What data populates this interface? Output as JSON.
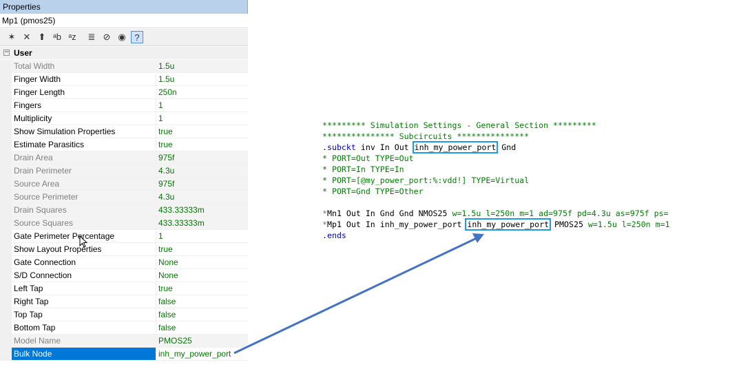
{
  "panel": {
    "title": "Properties",
    "object_name": "Mp1 (pmos25)",
    "toolbar": [
      {
        "name": "new-property-icon",
        "glyph": "✶"
      },
      {
        "name": "delete-icon",
        "glyph": "✕"
      },
      {
        "name": "move-up-icon",
        "glyph": "⬆"
      },
      {
        "name": "sort-ab-icon",
        "glyph": "ᵃb"
      },
      {
        "name": "sort-az-icon",
        "glyph": "ᵃz"
      },
      {
        "name": "stairs-icon",
        "glyph": "≣"
      },
      {
        "name": "no-entry-icon",
        "glyph": "⊘"
      },
      {
        "name": "eye-icon",
        "glyph": "◉"
      },
      {
        "name": "help-icon",
        "glyph": "?"
      }
    ],
    "category": {
      "expander": "−",
      "label": "User"
    },
    "rows": [
      {
        "name": "Total Width",
        "value": "1.5u",
        "readonly": true
      },
      {
        "name": "Finger Width",
        "value": "1.5u",
        "readonly": false
      },
      {
        "name": "Finger Length",
        "value": "250n",
        "readonly": false
      },
      {
        "name": "Fingers",
        "value": "1",
        "readonly": false
      },
      {
        "name": "Multiplicity",
        "value": "1",
        "readonly": false
      },
      {
        "name": "Show Simulation Properties",
        "value": "true",
        "readonly": false
      },
      {
        "name": "Estimate Parasitics",
        "value": "true",
        "readonly": false
      },
      {
        "name": "Drain Area",
        "value": "975f",
        "readonly": true
      },
      {
        "name": "Drain Perimeter",
        "value": "4.3u",
        "readonly": true
      },
      {
        "name": "Source Area",
        "value": "975f",
        "readonly": true
      },
      {
        "name": "Source Perimeter",
        "value": "4.3u",
        "readonly": true
      },
      {
        "name": "Drain Squares",
        "value": "433.33333m",
        "readonly": true
      },
      {
        "name": "Source Squares",
        "value": "433.33333m",
        "readonly": true
      },
      {
        "name": "Gate Perimeter Percentage",
        "value": "1",
        "readonly": false
      },
      {
        "name": "Show Layout Properties",
        "value": "true",
        "readonly": false
      },
      {
        "name": "Gate Connection",
        "value": "None",
        "readonly": false
      },
      {
        "name": "S/D Connection",
        "value": "None",
        "readonly": false
      },
      {
        "name": "Left Tap",
        "value": "true",
        "readonly": false
      },
      {
        "name": "Right Tap",
        "value": "false",
        "readonly": false
      },
      {
        "name": "Top Tap",
        "value": "false",
        "readonly": false
      },
      {
        "name": "Bottom Tap",
        "value": "false",
        "readonly": false
      },
      {
        "name": "Model Name",
        "value": "PMOS25",
        "readonly": true
      },
      {
        "name": "Bulk Node",
        "value": "inh_my_power_port",
        "readonly": false,
        "selected": true
      }
    ]
  },
  "netlist": {
    "lines": [
      {
        "cls": "c-comment",
        "text": "********* Simulation Settings - General Section *********"
      },
      {
        "cls": "c-comment",
        "text": "*************** Subcircuits ***************"
      },
      {
        "cls": "subckt"
      },
      {
        "cls": "c-comment",
        "text": "* PORT=Out TYPE=Out"
      },
      {
        "cls": "c-comment",
        "text": "* PORT=In TYPE=In"
      },
      {
        "cls": "c-comment",
        "text": "* PORT=[@my_power_port:%:vdd!] TYPE=Virtual"
      },
      {
        "cls": "c-comment",
        "text": "* PORT=Gnd TYPE=Other"
      },
      {
        "cls": "blank",
        "text": ""
      },
      {
        "cls": "mn1"
      },
      {
        "cls": "mp1"
      },
      {
        "cls": "c-kw",
        "text": ".ends"
      }
    ],
    "subckt": {
      "kw": ".subckt",
      "pre": " inv In Out ",
      "boxed": "inh_my_power_port",
      "post": " Gnd"
    },
    "mn1": {
      "mark": "*",
      "text": "Mn1 Out In Gnd Gnd NMOS25 ",
      "params": "w=1.5u l=250n m=1 ad=975f pd=4.3u as=975f ps="
    },
    "mp1": {
      "mark": "*",
      "pre": "Mp1 Out In inh_my_power_port ",
      "boxed": "inh_my_power_port",
      "post": " PMOS25 ",
      "params": "w=1.5u l=250n m=1"
    }
  },
  "colors": {
    "arrow": "#4472c4",
    "highlight_box": "#1e9be0",
    "selection": "#0078d7",
    "value_text": "#007800"
  }
}
